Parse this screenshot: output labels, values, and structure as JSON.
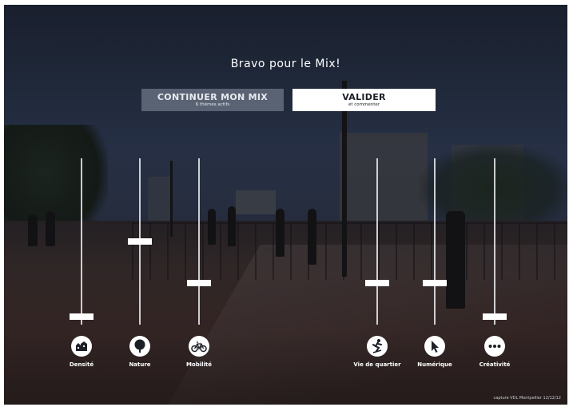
{
  "title": "Bravo pour le Mix!",
  "buttons": {
    "continue": {
      "label": "CONTINUER MON MIX",
      "sub": "6 thèmes actifs"
    },
    "validate": {
      "label": "VALIDER",
      "sub": "et commenter"
    }
  },
  "themes": [
    {
      "label": "Densité",
      "icon": "buildings-icon",
      "level": 0.03
    },
    {
      "label": "Nature",
      "icon": "tree-icon",
      "level": 0.5
    },
    {
      "label": "Mobilité",
      "icon": "bicycle-icon",
      "level": 0.24
    },
    {
      "label": "Vie de quartier",
      "icon": "skater-icon",
      "level": 0.24
    },
    {
      "label": "Numérique",
      "icon": "cursor-icon",
      "level": 0.24
    },
    {
      "label": "Créativité",
      "icon": "dots-icon",
      "level": 0.03
    }
  ],
  "credit": "capture VDL Montpellier 12/12/12",
  "colors": {
    "continue_bg": "#5a6373",
    "validate_bg": "#ffffff",
    "text": "#ffffff"
  }
}
